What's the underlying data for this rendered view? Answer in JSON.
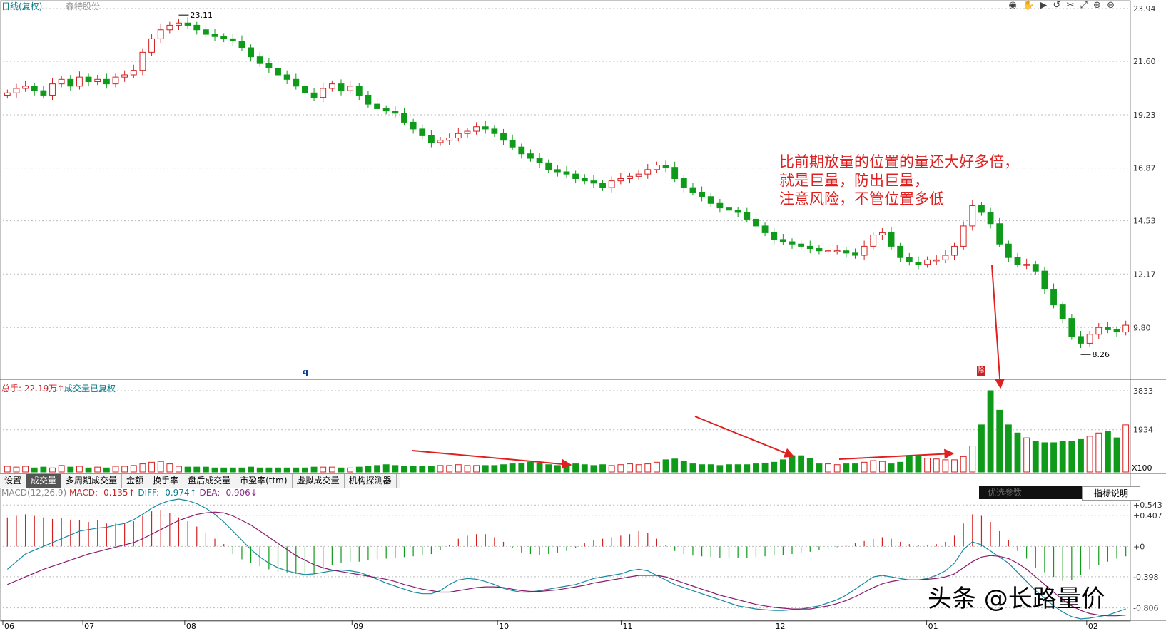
{
  "header": {
    "title": "日线(复权)",
    "stock_name": "森特股份"
  },
  "toolbar_icons": [
    "eye-icon",
    "hand-icon",
    "play-icon",
    "undo-icon",
    "scissors-icon",
    "expand-icon",
    "zoom-in-icon",
    "zoom-out-icon"
  ],
  "price_axis": [
    "23.94",
    "21.60",
    "19.23",
    "16.87",
    "14.53",
    "12.17",
    "9.80"
  ],
  "price_marks": {
    "high": "23.11",
    "low": "8.26"
  },
  "volume": {
    "label": "总手: 22.19万↑",
    "desc": "成交量已复权",
    "axis": [
      "3833",
      "1934"
    ],
    "unit": "X100"
  },
  "tabs": [
    "设置",
    "成交量",
    "多周期成交量",
    "金额",
    "换手率",
    "盘后成交量",
    "市盈率(ttm)",
    "虚拟成交量",
    "机构探测器"
  ],
  "active_tab": 1,
  "macd": {
    "title": "MACD(12,26,9)",
    "macd": "MACD: -0.135↑",
    "diff": "DIFF: -0.974↑",
    "dea": "DEA: -0.906↓",
    "axis": [
      "+0.543",
      "+0.407",
      "+0",
      "-0.398",
      "-0.806"
    ]
  },
  "options_box": "优选参数",
  "indicator_button": "指标说明",
  "dates": [
    "06",
    "07",
    "08",
    "09",
    "10",
    "11",
    "12",
    "01",
    "02"
  ],
  "markers": {
    "q": "q",
    "ab": "除"
  },
  "annotation": {
    "line1": "比前期放量的位置的量还大好多倍，",
    "line2": "就是巨量，防出巨量，",
    "line3": "注意风险，不管位置多低"
  },
  "watermark": "头条 @长路量价",
  "colors": {
    "up": "#d62020",
    "down": "#0f9a1a",
    "diff": "#1a8aa0",
    "dea": "#8a1a6a",
    "annotation": "#e02020"
  },
  "chart_data": {
    "type": "candlestick",
    "price_range": [
      7.5,
      23.94
    ],
    "closes": [
      20.2,
      20.4,
      20.5,
      20.3,
      20.1,
      20.6,
      20.8,
      20.5,
      20.9,
      20.7,
      20.8,
      20.6,
      20.9,
      21.0,
      21.2,
      22.0,
      22.6,
      23.0,
      23.2,
      23.3,
      23.2,
      23.0,
      22.8,
      22.7,
      22.6,
      22.5,
      22.2,
      21.8,
      21.5,
      21.3,
      21.0,
      20.8,
      20.5,
      20.2,
      20.0,
      20.4,
      20.6,
      20.3,
      20.5,
      20.1,
      19.7,
      19.5,
      19.4,
      19.3,
      18.9,
      18.6,
      18.3,
      18.0,
      18.1,
      18.2,
      18.4,
      18.5,
      18.7,
      18.6,
      18.4,
      18.1,
      17.8,
      17.5,
      17.3,
      17.1,
      16.8,
      16.7,
      16.6,
      16.4,
      16.3,
      16.2,
      16.0,
      16.3,
      16.4,
      16.5,
      16.6,
      16.8,
      17.0,
      16.9,
      16.4,
      16.0,
      15.8,
      15.6,
      15.3,
      15.1,
      15.0,
      14.9,
      14.6,
      14.3,
      14.0,
      13.7,
      13.6,
      13.5,
      13.4,
      13.3,
      13.2,
      13.2,
      13.2,
      13.1,
      13.0,
      13.4,
      13.9,
      14.0,
      13.4,
      12.9,
      12.7,
      12.6,
      12.8,
      12.8,
      13.0,
      13.4,
      14.3,
      15.2,
      14.9,
      14.4,
      13.5,
      12.9,
      12.6,
      12.6,
      12.3,
      11.5,
      10.8,
      10.2,
      9.4,
      9.1,
      9.5,
      9.8,
      9.7,
      9.6,
      9.9
    ],
    "volumes": [
      0.07,
      0.06,
      0.07,
      0.05,
      0.06,
      0.05,
      0.08,
      0.06,
      0.07,
      0.05,
      0.06,
      0.05,
      0.07,
      0.07,
      0.08,
      0.1,
      0.12,
      0.13,
      0.1,
      0.07,
      0.06,
      0.06,
      0.06,
      0.05,
      0.05,
      0.05,
      0.05,
      0.06,
      0.05,
      0.05,
      0.05,
      0.05,
      0.05,
      0.05,
      0.06,
      0.06,
      0.06,
      0.05,
      0.05,
      0.06,
      0.07,
      0.08,
      0.09,
      0.08,
      0.07,
      0.07,
      0.07,
      0.07,
      0.08,
      0.08,
      0.09,
      0.08,
      0.08,
      0.08,
      0.08,
      0.09,
      0.1,
      0.11,
      0.12,
      0.11,
      0.09,
      0.08,
      0.09,
      0.1,
      0.09,
      0.08,
      0.09,
      0.08,
      0.09,
      0.1,
      0.09,
      0.1,
      0.12,
      0.15,
      0.16,
      0.13,
      0.1,
      0.09,
      0.09,
      0.08,
      0.09,
      0.09,
      0.09,
      0.1,
      0.11,
      0.12,
      0.15,
      0.2,
      0.2,
      0.17,
      0.1,
      0.1,
      0.09,
      0.1,
      0.1,
      0.12,
      0.14,
      0.13,
      0.1,
      0.12,
      0.2,
      0.2,
      0.17,
      0.16,
      0.15,
      0.15,
      0.19,
      0.32,
      0.58,
      1.0,
      0.76,
      0.58,
      0.48,
      0.42,
      0.38,
      0.36,
      0.36,
      0.38,
      0.38,
      0.4,
      0.44,
      0.48,
      0.5,
      0.42,
      0.58
    ],
    "macd_range": [
      -0.95,
      0.62
    ],
    "macd_hist": [
      0.38,
      0.4,
      0.42,
      0.4,
      0.38,
      0.36,
      0.37,
      0.35,
      0.34,
      0.32,
      0.34,
      0.3,
      0.3,
      0.31,
      0.33,
      0.4,
      0.46,
      0.48,
      0.44,
      0.38,
      0.33,
      0.26,
      0.18,
      0.1,
      0.03,
      -0.1,
      -0.17,
      -0.22,
      -0.26,
      -0.3,
      -0.33,
      -0.34,
      -0.36,
      -0.38,
      -0.36,
      -0.3,
      -0.25,
      -0.22,
      -0.2,
      -0.2,
      -0.18,
      -0.17,
      -0.16,
      -0.15,
      -0.14,
      -0.13,
      -0.12,
      -0.1,
      -0.05,
      0.02,
      0.1,
      0.14,
      0.16,
      0.16,
      0.12,
      0.06,
      -0.02,
      -0.08,
      -0.1,
      -0.11,
      -0.1,
      -0.08,
      -0.06,
      -0.02,
      0.04,
      0.08,
      0.1,
      0.12,
      0.14,
      0.16,
      0.2,
      0.18,
      0.1,
      0.02,
      -0.06,
      -0.1,
      -0.12,
      -0.13,
      -0.14,
      -0.15,
      -0.15,
      -0.15,
      -0.15,
      -0.14,
      -0.13,
      -0.12,
      -0.11,
      -0.1,
      -0.09,
      -0.07,
      -0.05,
      -0.03,
      -0.01,
      0.01,
      0.04,
      0.07,
      0.1,
      0.12,
      0.1,
      0.06,
      0.03,
      0.02,
      0.01,
      0.03,
      0.06,
      0.14,
      0.3,
      0.42,
      0.4,
      0.32,
      0.2,
      0.08,
      -0.06,
      -0.16,
      -0.28,
      -0.34,
      -0.4,
      -0.45,
      -0.44,
      -0.38,
      -0.3,
      -0.24,
      -0.2,
      -0.16,
      -0.13
    ],
    "diff": [
      -0.3,
      -0.2,
      -0.1,
      -0.05,
      0.0,
      0.05,
      0.1,
      0.15,
      0.2,
      0.22,
      0.24,
      0.25,
      0.28,
      0.3,
      0.35,
      0.42,
      0.5,
      0.56,
      0.6,
      0.62,
      0.6,
      0.56,
      0.5,
      0.42,
      0.32,
      0.2,
      0.08,
      -0.04,
      -0.14,
      -0.22,
      -0.28,
      -0.32,
      -0.35,
      -0.37,
      -0.36,
      -0.34,
      -0.32,
      -0.31,
      -0.32,
      -0.34,
      -0.38,
      -0.43,
      -0.48,
      -0.52,
      -0.56,
      -0.6,
      -0.62,
      -0.62,
      -0.58,
      -0.5,
      -0.44,
      -0.42,
      -0.43,
      -0.46,
      -0.5,
      -0.55,
      -0.58,
      -0.6,
      -0.6,
      -0.58,
      -0.56,
      -0.54,
      -0.52,
      -0.5,
      -0.46,
      -0.42,
      -0.4,
      -0.38,
      -0.36,
      -0.32,
      -0.3,
      -0.32,
      -0.38,
      -0.44,
      -0.5,
      -0.54,
      -0.58,
      -0.62,
      -0.66,
      -0.7,
      -0.74,
      -0.78,
      -0.8,
      -0.82,
      -0.83,
      -0.84,
      -0.84,
      -0.83,
      -0.82,
      -0.8,
      -0.78,
      -0.74,
      -0.7,
      -0.64,
      -0.56,
      -0.48,
      -0.4,
      -0.38,
      -0.4,
      -0.42,
      -0.44,
      -0.44,
      -0.42,
      -0.38,
      -0.32,
      -0.22,
      -0.04,
      0.06,
      0.02,
      -0.06,
      -0.14,
      -0.22,
      -0.34,
      -0.46,
      -0.58,
      -0.68,
      -0.78,
      -0.86,
      -0.92,
      -0.95,
      -0.94,
      -0.92,
      -0.9,
      -0.86,
      -0.82
    ],
    "dea": [
      -0.5,
      -0.45,
      -0.4,
      -0.35,
      -0.3,
      -0.26,
      -0.22,
      -0.18,
      -0.14,
      -0.1,
      -0.07,
      -0.04,
      -0.01,
      0.02,
      0.05,
      0.1,
      0.16,
      0.22,
      0.28,
      0.34,
      0.38,
      0.42,
      0.44,
      0.45,
      0.44,
      0.4,
      0.34,
      0.28,
      0.2,
      0.12,
      0.04,
      -0.04,
      -0.12,
      -0.18,
      -0.24,
      -0.28,
      -0.31,
      -0.33,
      -0.35,
      -0.37,
      -0.39,
      -0.41,
      -0.43,
      -0.46,
      -0.5,
      -0.53,
      -0.56,
      -0.58,
      -0.6,
      -0.6,
      -0.58,
      -0.56,
      -0.54,
      -0.53,
      -0.53,
      -0.54,
      -0.56,
      -0.58,
      -0.59,
      -0.59,
      -0.58,
      -0.57,
      -0.55,
      -0.53,
      -0.51,
      -0.48,
      -0.46,
      -0.44,
      -0.42,
      -0.4,
      -0.38,
      -0.38,
      -0.38,
      -0.4,
      -0.44,
      -0.48,
      -0.52,
      -0.56,
      -0.6,
      -0.64,
      -0.67,
      -0.7,
      -0.73,
      -0.76,
      -0.78,
      -0.8,
      -0.81,
      -0.82,
      -0.82,
      -0.82,
      -0.8,
      -0.78,
      -0.75,
      -0.71,
      -0.66,
      -0.6,
      -0.54,
      -0.49,
      -0.46,
      -0.44,
      -0.44,
      -0.44,
      -0.43,
      -0.42,
      -0.4,
      -0.36,
      -0.28,
      -0.2,
      -0.14,
      -0.12,
      -0.13,
      -0.16,
      -0.22,
      -0.3,
      -0.4,
      -0.5,
      -0.6,
      -0.7,
      -0.78,
      -0.84,
      -0.88,
      -0.9,
      -0.91,
      -0.91,
      -0.9
    ]
  }
}
